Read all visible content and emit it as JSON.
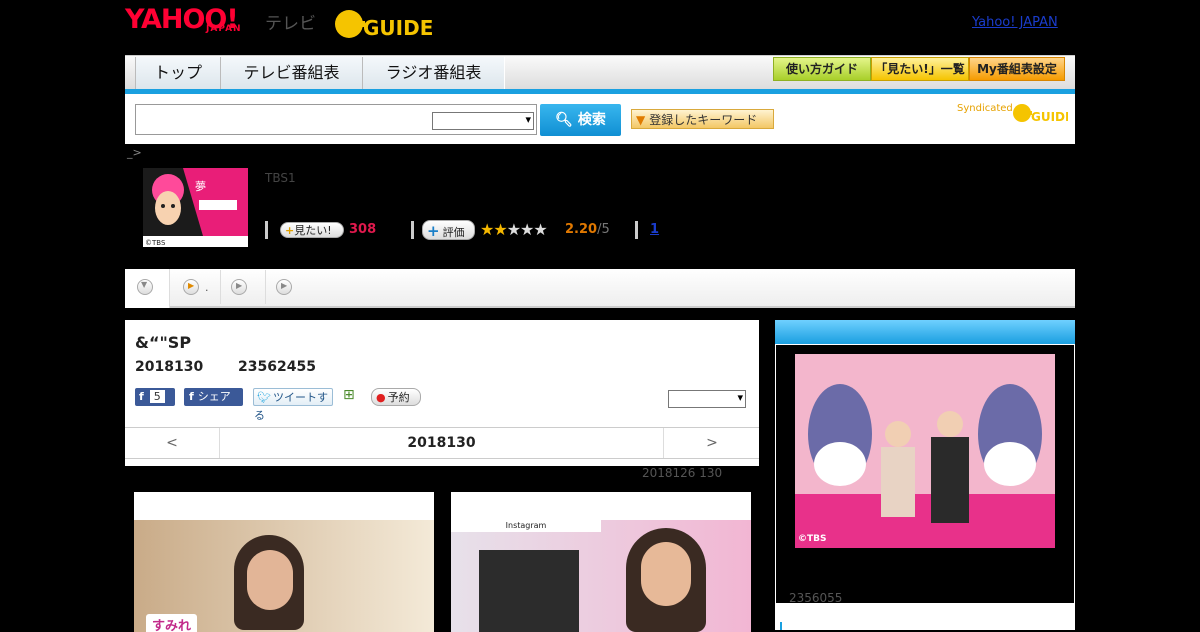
{
  "header": {
    "logo_text": "YAHOO!",
    "logo_sub": "JAPAN",
    "tv_label": "テレビ",
    "gguide_logo": "G-GUIDE",
    "yahoo_japan_link": "Yahoo! JAPAN"
  },
  "nav": {
    "tabs": [
      {
        "label": "トップ"
      },
      {
        "label": "テレビ番組表"
      },
      {
        "label": "ラジオ番組表"
      }
    ],
    "right_buttons": [
      {
        "label": "使い方ガイド"
      },
      {
        "label": "「見たい!」一覧"
      },
      {
        "label": "My番組表設定"
      }
    ]
  },
  "search": {
    "input_value": "",
    "select_value": "",
    "button_label": "検索",
    "keyword_button": "登録したキーワード",
    "syndicated_label": "Syndicated"
  },
  "breadcrumb": "_>",
  "program": {
    "channel": "TBS1",
    "want_label": "見たい!",
    "want_count": "308",
    "rate_label": "評価",
    "rating": "2.20",
    "rating_max": "/5",
    "review_link": "1",
    "thumb_credit": "©TBS"
  },
  "tab_strip": {
    "tab2_text": "."
  },
  "episode": {
    "title": "&“\"SP",
    "date": "2018130",
    "count": "23562455",
    "fb_count": "5",
    "share_label": "シェア",
    "tweet_label": "ツイートする",
    "reserve_label": "予約",
    "pager_prev": "<",
    "pager_current": "2018130",
    "pager_next": ">",
    "footnote": "2018126  130"
  },
  "right_column": {
    "image_credit": "©TBS",
    "footer_text": "2356055"
  },
  "cards": [
    {
      "caption": "すみれ"
    },
    {
      "caption": "Instagram"
    }
  ],
  "colors": {
    "brand_red": "#ff0033",
    "accent_blue": "#1aa0e0",
    "gguide_yellow": "#f5c400"
  }
}
